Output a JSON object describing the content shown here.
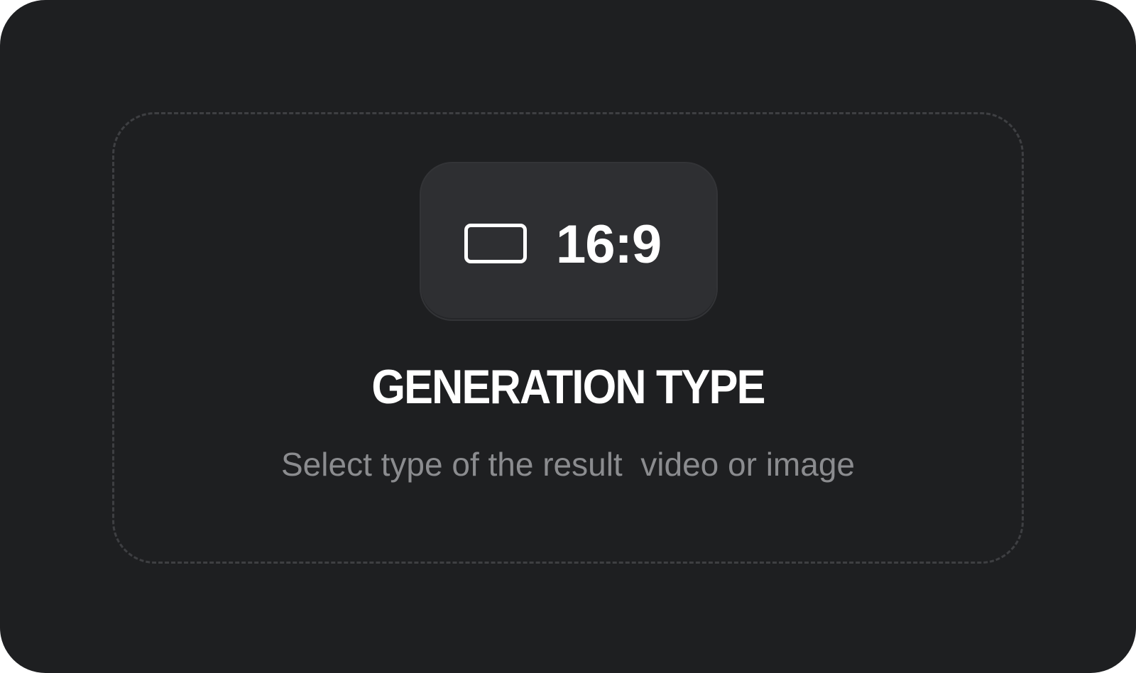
{
  "card": {
    "background": "#1e1f21",
    "dropzone_border_color": "#3e3f42"
  },
  "ratio_chip": {
    "icon": "aspect-ratio-rectangle-icon",
    "label": "16:9",
    "background": "#2e2f32"
  },
  "title": "GENERATION TYPE",
  "subtitle": "Select type of the result  video or image",
  "colors": {
    "title": "#ffffff",
    "subtitle": "#8b8c8f"
  }
}
